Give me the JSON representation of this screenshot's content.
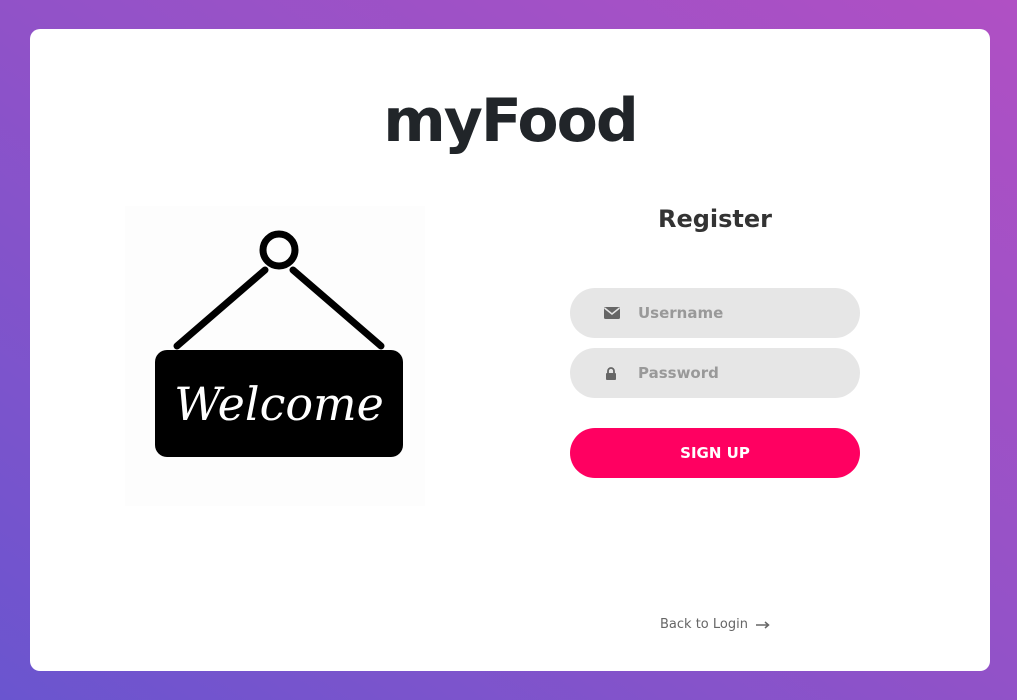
{
  "brand": {
    "title": "myFood"
  },
  "illustration": {
    "sign_text": "Welcome",
    "icon": "welcome-sign-icon"
  },
  "form": {
    "title": "Register",
    "username": {
      "placeholder": "Username",
      "value": "",
      "icon": "envelope-icon"
    },
    "password": {
      "placeholder": "Password",
      "value": "",
      "icon": "lock-icon"
    },
    "submit_label": "Sign Up"
  },
  "footer": {
    "back_label": "Back to Login",
    "icon": "arrow-right-icon"
  },
  "colors": {
    "accent": "#ff0061",
    "input_bg": "#e6e6e6",
    "gradient_start": "#6a55cf",
    "gradient_end": "#b050c4",
    "text_dark": "#212529"
  }
}
